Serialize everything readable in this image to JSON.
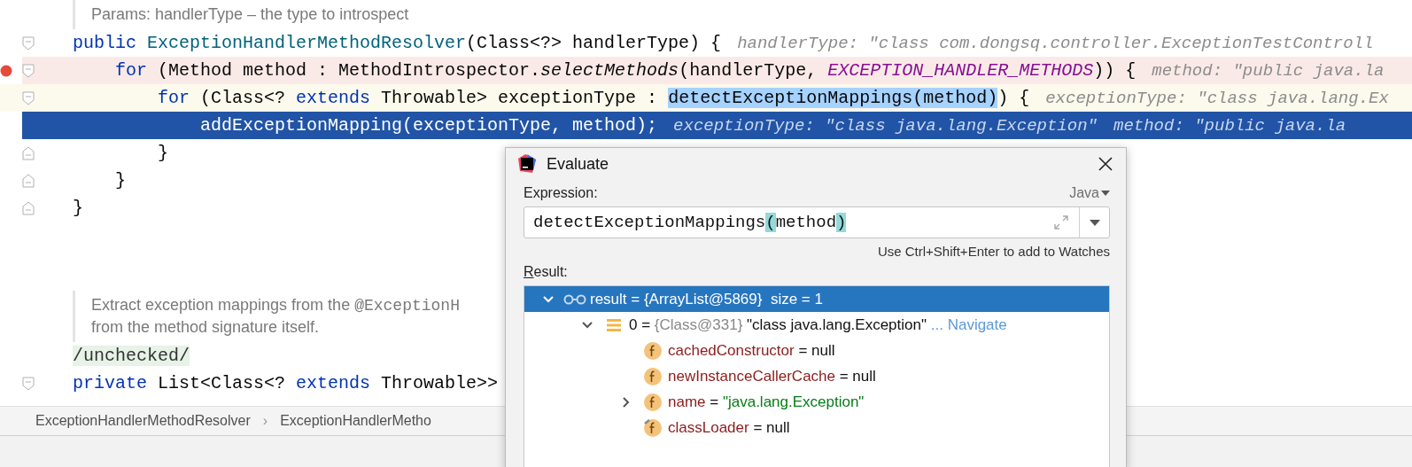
{
  "editor": {
    "blocks": [
      {
        "kind": "doc",
        "lines": [
          [
            {
              "kind": "text",
              "text": "Params: handlerType – the type to introspect"
            }
          ]
        ]
      },
      {
        "kind": "code",
        "fold_start": true,
        "fold_end": false,
        "breakpoint": false,
        "current": false,
        "execution": false,
        "segments": [
          {
            "kind": "kw",
            "text": "public "
          },
          {
            "kind": "decl",
            "text": "ExceptionHandlerMethodResolver"
          },
          {
            "kind": "plain",
            "text": "(Class<?> handlerType) {"
          }
        ],
        "hints": [
          "handlerType: \"class com.dongsq.controller.ExceptionTestControll"
        ],
        "children": [
          {
            "kind": "code",
            "fold_start": true,
            "fold_end": false,
            "breakpoint": true,
            "current": false,
            "execution": false,
            "segments": [
              {
                "kind": "kw",
                "text": "for"
              },
              {
                "kind": "plain",
                "text": " (Method method : MethodIntrospector."
              },
              {
                "kind": "italic",
                "text": "selectMethods"
              },
              {
                "kind": "plain",
                "text": "(handlerType, "
              },
              {
                "kind": "const",
                "text": "EXCEPTION_HANDLER_METHODS"
              },
              {
                "kind": "plain",
                "text": ")) {"
              }
            ],
            "hints": [
              "method: \"public java.la"
            ],
            "children": [
              {
                "kind": "code",
                "fold_start": true,
                "fold_end": false,
                "breakpoint": false,
                "current": true,
                "execution": false,
                "segments": [
                  {
                    "kind": "kw",
                    "text": "for"
                  },
                  {
                    "kind": "plain",
                    "text": " (Class<? "
                  },
                  {
                    "kind": "kw",
                    "text": "extends"
                  },
                  {
                    "kind": "plain",
                    "text": " Throwable> exceptionType : "
                  },
                  {
                    "kind": "selection",
                    "text": "detectExceptionMappings(method)"
                  },
                  {
                    "kind": "plain",
                    "text": ") {"
                  }
                ],
                "hints": [
                  "exceptionType: \"class java.lang.Ex"
                ],
                "children": [
                  {
                    "kind": "code",
                    "fold_start": false,
                    "fold_end": false,
                    "breakpoint": false,
                    "current": false,
                    "execution": true,
                    "segments": [
                      {
                        "kind": "plain",
                        "text": "addExceptionMapping(exceptionType, method);"
                      }
                    ],
                    "hints": [
                      "exceptionType: \"class java.lang.Exception\"",
                      "method: \"public java.la"
                    ]
                  }
                ]
              },
              {
                "kind": "code",
                "fold_start": false,
                "fold_end": true,
                "breakpoint": false,
                "current": false,
                "execution": false,
                "segments": [
                  {
                    "kind": "plain",
                    "text": "}"
                  }
                ]
              }
            ]
          },
          {
            "kind": "code",
            "fold_start": false,
            "fold_end": true,
            "breakpoint": false,
            "current": false,
            "execution": false,
            "segments": [
              {
                "kind": "plain",
                "text": "}"
              }
            ]
          }
        ]
      },
      {
        "kind": "code",
        "fold_start": false,
        "fold_end": true,
        "breakpoint": false,
        "current": false,
        "execution": false,
        "segments": [
          {
            "kind": "plain",
            "text": "}"
          }
        ]
      },
      {
        "kind": "doc",
        "lines": [
          [
            {
              "kind": "text",
              "text": "Extract exception mappings from the "
            },
            {
              "kind": "code",
              "text": "@ExceptionH"
            }
          ],
          [
            {
              "kind": "text",
              "text": "from the method signature itself."
            }
          ]
        ]
      },
      {
        "kind": "code",
        "fold_start": false,
        "fold_end": false,
        "breakpoint": false,
        "current": false,
        "execution": false,
        "segments": [
          {
            "kind": "annotation",
            "text": "/unchecked/"
          }
        ]
      },
      {
        "kind": "code",
        "fold_start": true,
        "fold_end": false,
        "breakpoint": false,
        "current": false,
        "execution": false,
        "segments": [
          {
            "kind": "kw",
            "text": "private "
          },
          {
            "kind": "plain",
            "text": "List<Class<? "
          },
          {
            "kind": "kw",
            "text": "extends"
          },
          {
            "kind": "plain",
            "text": " Throwable>> "
          }
        ]
      }
    ]
  },
  "breadcrumbs": [
    "ExceptionHandlerMethodResolver",
    "ExceptionHandlerMetho"
  ],
  "breadcrumb_separator": "›",
  "dialog": {
    "title": "Evaluate",
    "expression_label": "Expression:",
    "language": "Java",
    "expression": [
      {
        "kind": "plain",
        "text": "detectExceptionMappings"
      },
      {
        "kind": "brace",
        "text": "("
      },
      {
        "kind": "plain",
        "text": "method"
      },
      {
        "kind": "brace",
        "text": ")"
      }
    ],
    "hint": "Use Ctrl+Shift+Enter to add to Watches",
    "result_label": "Result:",
    "tree": [
      {
        "kind": "watch",
        "selected": true,
        "expanded": true,
        "parts": [
          {
            "kind": "plain",
            "text": "result = {ArrayList@5869}  size = 1"
          }
        ],
        "children": [
          {
            "kind": "list",
            "selected": false,
            "expanded": true,
            "parts": [
              {
                "kind": "plain",
                "text": "0 = "
              },
              {
                "kind": "ref",
                "text": "{Class@331} "
              },
              {
                "kind": "plain",
                "text": "\"class java.lang.Exception\""
              },
              {
                "kind": "link",
                "text": " ... Navigate"
              }
            ],
            "children": [
              {
                "kind": "field",
                "selected": false,
                "parts": [
                  {
                    "kind": "name",
                    "text": "cachedConstructor"
                  },
                  {
                    "kind": "plain",
                    "text": " = null"
                  }
                ]
              },
              {
                "kind": "field",
                "selected": false,
                "parts": [
                  {
                    "kind": "name",
                    "text": "newInstanceCallerCache"
                  },
                  {
                    "kind": "plain",
                    "text": " = null"
                  }
                ]
              },
              {
                "kind": "field",
                "selected": false,
                "expanded": false,
                "parts": [
                  {
                    "kind": "name",
                    "text": "name"
                  },
                  {
                    "kind": "plain",
                    "text": " = "
                  },
                  {
                    "kind": "string",
                    "text": "\"java.lang.Exception\""
                  }
                ]
              },
              {
                "kind": "field_marked",
                "selected": false,
                "parts": [
                  {
                    "kind": "name",
                    "text": "classLoader"
                  },
                  {
                    "kind": "plain",
                    "text": " = null"
                  }
                ]
              }
            ]
          }
        ]
      }
    ]
  }
}
